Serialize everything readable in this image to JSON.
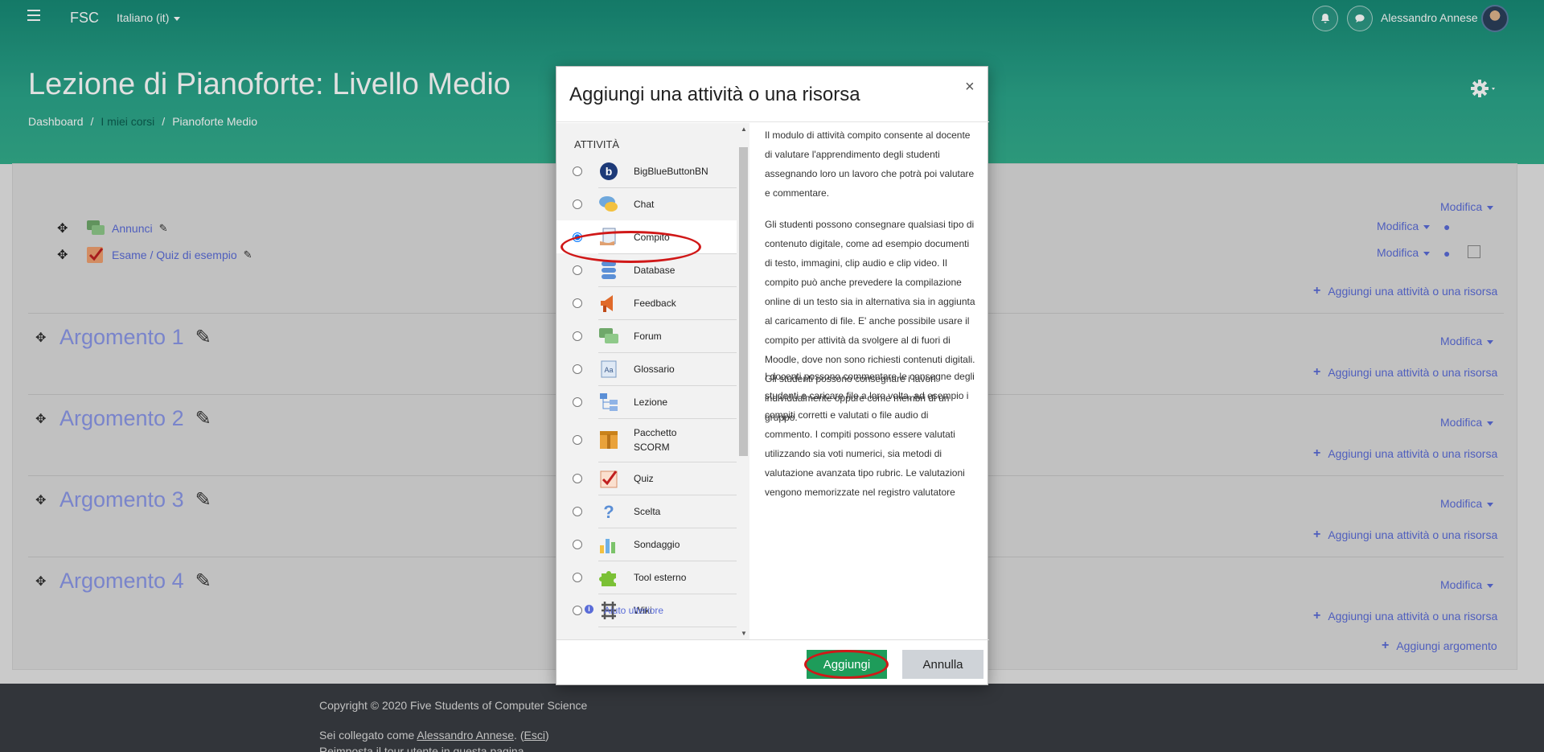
{
  "navbar": {
    "brand": "FSC",
    "language": "Italiano (it)",
    "user_name": "Alessandro Annese"
  },
  "header": {
    "title": "Lezione di Pianoforte: Livello Medio",
    "breadcrumb": [
      "Dashboard",
      "I miei corsi",
      "Pianoforte Medio"
    ]
  },
  "course": {
    "general_items": [
      {
        "label": "Annunci",
        "icon": "forum-icon"
      },
      {
        "label": "Esame / Quiz di esempio",
        "icon": "quiz-icon"
      }
    ],
    "modifica_label": "Modifica",
    "add_activity_label": "Aggiungi una attività o una risorsa",
    "sections": [
      "Argomento 1",
      "Argomento 2",
      "Argomento 3",
      "Argomento 4"
    ],
    "add_section_label": "Aggiungi argomento"
  },
  "modal": {
    "title": "Aggiungi una attività o una risorsa",
    "close": "×",
    "category": "ATTIVITÀ",
    "options": [
      {
        "label": "BigBlueButtonBN",
        "icon": "bigbluebutton-icon",
        "selected": false
      },
      {
        "label": "Chat",
        "icon": "chat-icon",
        "selected": false
      },
      {
        "label": "Compito",
        "icon": "assignment-icon",
        "selected": true
      },
      {
        "label": "Database",
        "icon": "database-icon",
        "selected": false
      },
      {
        "label": "Feedback",
        "icon": "feedback-icon",
        "selected": false
      },
      {
        "label": "Forum",
        "icon": "forum-icon",
        "selected": false
      },
      {
        "label": "Glossario",
        "icon": "glossary-icon",
        "selected": false
      },
      {
        "label": "Lezione",
        "icon": "lesson-icon",
        "selected": false
      },
      {
        "label": "Pacchetto SCORM",
        "icon": "scorm-icon",
        "selected": false
      },
      {
        "label": "Quiz",
        "icon": "quiz-icon",
        "selected": false
      },
      {
        "label": "Scelta",
        "icon": "choice-icon",
        "selected": false
      },
      {
        "label": "Sondaggio",
        "icon": "survey-icon",
        "selected": false
      },
      {
        "label": "Tool esterno",
        "icon": "external-tool-icon",
        "selected": false
      },
      {
        "label": "Wiki",
        "icon": "wiki-icon",
        "selected": false
      }
    ],
    "description": [
      "Il modulo di attività compito consente al docente di valutare l'apprendimento degli studenti assegnando loro un lavoro che potrà poi valutare e commentare.",
      "Gli studenti possono consegnare qualsiasi tipo di contenuto digitale, come ad esempio documenti di testo, immagini, clip audio e clip video. Il compito può anche prevedere la compilazione online di un testo sia in alternativa sia in aggiunta al caricamento di file. E' anche possibile usare il compito per attività da svolgere al di fuori di Moodle, dove non sono richiesti contenuti digitali. Gli studenti possono consegnare i lavori individualmente oppure come membri di un gruppo.",
      "I docenti possono commentare le consegne degli studenti e caricare file a loro volta, ad esempio i compiti corretti e valutati o file audio di commento. I compiti possono essere valutati utilizzando sia voti numerici, sia metodi di valutazione avanzata tipo rubric. Le valutazioni vengono memorizzate nel registro valutatore"
    ],
    "help_link": "Aiuto ulteriore",
    "add_button": "Aggiungi",
    "cancel_button": "Annulla"
  },
  "footer": {
    "copyright": "Copyright © 2020 Five Students of Computer Science",
    "logged_in_prefix": "Sei collegato come ",
    "logged_in_user": "Alessandro Annese",
    "logged_in_mid": ". (",
    "logout": "Esci",
    "logged_in_suffix": ")",
    "tour": "Reimposta il tour utente in questa pagina"
  },
  "colors": {
    "header": "#2ba58a",
    "link": "#5a6cd8",
    "add_button": "#1e9c5a",
    "highlight": "#d01818"
  }
}
